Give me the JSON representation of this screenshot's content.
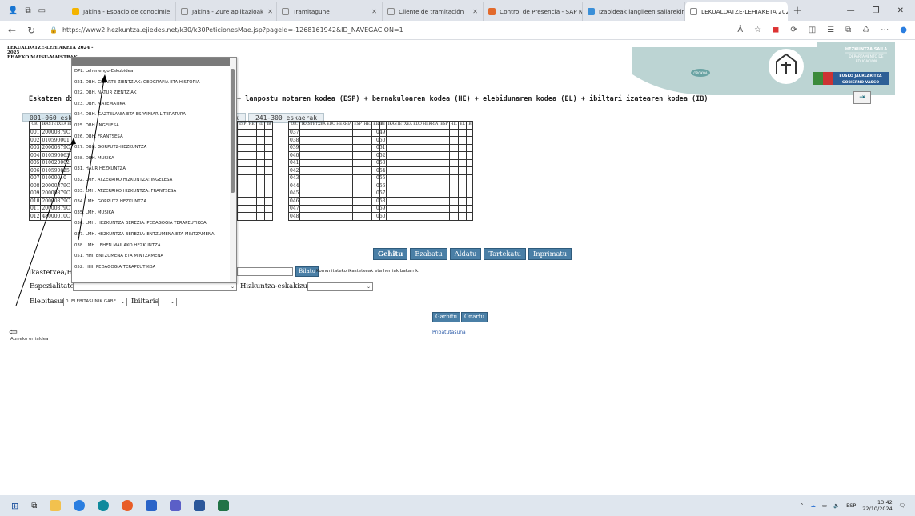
{
  "browser": {
    "tabs": [
      {
        "label": "Jakina - Espacio de conocimie",
        "color": "#f4b400"
      },
      {
        "label": "Jakina - Zure aplikazioak",
        "color": "#c8c8c8"
      },
      {
        "label": "Tramitagune",
        "color": "#c8c8c8"
      },
      {
        "label": "Cliente de tramitación",
        "color": "#c8c8c8"
      },
      {
        "label": "Control de Presencia - SAP Ne",
        "color": "#e26a2c"
      },
      {
        "label": "Izapideak langileen sailarekin",
        "color": "#3b8fd8"
      },
      {
        "label": "LEKUALDATZE-LEHIAKETA 202",
        "color": "#c8c8c8"
      }
    ],
    "url": "https://www2.hezkuntza.ejiedes.net/k30/k30PeticionesMae.jsp?pageId=-1268161942&ID_NAVEGACION=1",
    "url_host": "www2.hezkuntza.ejiedes.net"
  },
  "header": {
    "line1": "LEKUALDATZE-LEHIAKETA 2024 -",
    "line2": "2025",
    "line3": "EHAEKO MAISU-MAISTRAK",
    "dept_eu": "HEZKUNTZA SAILA",
    "dept_es_1": "DEPARTAMENTO DE",
    "dept_es_2": "EDUCACIÓN",
    "gov_1": "EUSKO JAURLARITZA",
    "gov_2": "GOBIERNO VASCO",
    "round_badge": "OROKOA"
  },
  "instructions": {
    "left": "Eskatzen ditu",
    "right": "+ lanpostu motaren kodea (ESP) + bernakuloaren kodea (HE) + elebidunaren kodea (EL) + ibiltari izatearen kodea (IB)"
  },
  "range_tabs": [
    "001-060 esk",
    "40 eskaerak",
    "241-300 eskaerak"
  ],
  "grid": {
    "col_or": "OR.",
    "col_center": "IKASTETXEA EDO HERRIA",
    "col_esp": "ESP",
    "col_he": "HE.",
    "col_el": "EL",
    "col_ib": "IB",
    "first_rows": [
      {
        "or": "001",
        "code": "20000879C"
      },
      {
        "or": "002",
        "code": "010590001"
      },
      {
        "or": "003",
        "code": "20000879C"
      },
      {
        "or": "004",
        "code": "010590063"
      },
      {
        "or": "005",
        "code": "010020002"
      },
      {
        "or": "006",
        "code": "010590025"
      },
      {
        "or": "007",
        "code": "01000010"
      },
      {
        "or": "008",
        "code": "20000879C"
      },
      {
        "or": "009",
        "code": "20000879C"
      },
      {
        "or": "010",
        "code": "20000879C"
      },
      {
        "or": "011",
        "code": "20000879C"
      },
      {
        "or": "012",
        "code": "48000010C"
      }
    ],
    "col3_nums": [
      "037",
      "038",
      "039",
      "040",
      "041",
      "042",
      "043",
      "044",
      "045",
      "046",
      "047",
      "048"
    ],
    "col4_nums": [
      "049",
      "050",
      "051",
      "052",
      "053",
      "054",
      "055",
      "056",
      "057",
      "058",
      "059",
      "060"
    ]
  },
  "buttons": {
    "gehitu": "Gehitu",
    "ezabatu": "Ezabatu",
    "aldatu": "Aldatu",
    "tartekatu": "Tartekatu",
    "inprimatu": "Inprimatu",
    "bilatu": "Bilatu",
    "garbitu": "Garbitu",
    "onartu": "Onartu"
  },
  "form": {
    "center_label": "Ikastetxea/Her",
    "community_note": "Komunitateko ikastetxeak eta herriak bakarrik.",
    "specialty_label": "Espezialitatea",
    "language_label": "Hizkuntza-eskakizuna",
    "bilingual_label": "Elebitasun",
    "bilingual_value": "0. ELEBITASUNIK GABE",
    "itinerant_label": "Ibiltaria",
    "privacy_link": "Pribatutasuna",
    "back_label": "Aurreko orrialdea"
  },
  "dropdown": {
    "items": [
      "DPL. Lehenengo-Eskubidea",
      "021. DBH. GIZARTE ZIENTZIAK: GEOGRAFIA ETA HISTORIA",
      "022. DBH. NATUR ZIENTZIAK",
      "023. DBH. MATEMATIKA",
      "024. DBH. GAZTELANIA ETA ESPAINIAR LITERATURA",
      "025. DBH. INGELESA",
      "026. DBH. FRANTSESA",
      "027. DBH. GORPUTZ-HEZKUNTZA",
      "028. DBH. MUSIKA",
      "031. HAUR HEZKUNTZA",
      "032. LMH. ATZERRIKO HIZKUNTZA: INGELESA",
      "033. LMH. ATZERRIKO HIZKUNTZA: FRANTSESA",
      "034. LMH. GORPUTZ HEZKUNTZA",
      "035. LMH. MUSIKA",
      "036. LMH. HEZKUNTZA BEREZIA: PEDAGOGIA TERAPEUTIKOA",
      "037. LMH. HEZKUNTZA BEREZIA: ENTZUMENA ETA MINTZAMENA",
      "038. LMH. LEHEN MAILAKO HEZKUNTZA",
      "051. HHI. ENTZUMENA ETA MINTZAMENA",
      "052. HHI. PEDAGOGIA TERAPEUTIKOA"
    ]
  },
  "taskbar": {
    "lang": "ESP",
    "time": "13:42",
    "date": "22/10/2024"
  }
}
